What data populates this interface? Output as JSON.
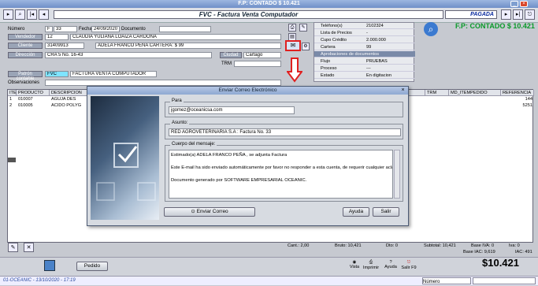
{
  "window": {
    "title": "F.P: CONTADO $ 10.421"
  },
  "form": {
    "title": "FVC - Factura Venta Computador",
    "status": "PAGADA"
  },
  "header": {
    "numero_label": "Número",
    "numero_prefix": "F",
    "numero_value": "33",
    "fecha_label": "Fecha",
    "fecha_value": "24/09/2020",
    "documento_label": "Documento",
    "documento_value": "",
    "vendedor_label": "Vendedor",
    "vendedor_code": "12",
    "vendedor_name": "CLAUDIA YULIANA LOAIZA CARDONA",
    "cliente_label": "Cliente",
    "cliente_code": "31409913",
    "cliente_name": "ADELA  FRANCO PEÑA  CARTERA: $ 99",
    "direccion_label": "Dirección",
    "direccion_value": "CRA 5 No. 16-43",
    "ciudad_label": "Ciudad",
    "ciudad_value": "Cartago",
    "trm_label": "TRM",
    "trm_value": "",
    "patron_label": "Patrón contable",
    "patron_code": "FVC",
    "patron_name": "FACTURA VENTA COMPUTADOR",
    "observaciones_label": "Observaciones",
    "observaciones_value": ""
  },
  "properties": [
    {
      "label": "Teléfono(s)",
      "value": "2102324"
    },
    {
      "label": "Lista de Precios",
      "value": "-"
    },
    {
      "label": "Cupo Crédito",
      "value": "2.000.000"
    },
    {
      "label": "Cartera",
      "value": "99"
    },
    {
      "label": "Aprobaciones de documentos",
      "value": ""
    },
    {
      "label": "Flujo",
      "value": "PRUEBAS"
    },
    {
      "label": "Proceso",
      "value": "---"
    },
    {
      "label": "Estado",
      "value": "En digitacion"
    }
  ],
  "fp_summary": "F.P: CONTADO $ 10.421",
  "grid": {
    "columns": [
      "ITE",
      "PRODUCTO",
      "DESCRIPCION",
      "TRM",
      "MD_ITEMPEDIDO",
      "REFERENCIA"
    ],
    "rows": [
      {
        "ite": "1",
        "producto": "010007",
        "descripcion": "AGUJA DES",
        "referencia": "144"
      },
      {
        "ite": "2",
        "producto": "010005",
        "descripcion": "ACIDO POLYG",
        "referencia": "5251"
      }
    ]
  },
  "email_dialog": {
    "title": "Enviar Correo Electrónico",
    "para_label": "Para",
    "para_value": "jgomez@oceanicsa.com",
    "asunto_label": "Asunto:",
    "asunto_value": "RED AGROVETERINARIA S.A : Factura No. 33",
    "cuerpo_label": "Cuerpo del mensaje:",
    "cuerpo_lines": [
      "Estimado(a) ADELA  FRANCO PEÑA , se adjunta Factura",
      "",
      "Este E-mail ha sido enviado automáticamente por favor no responder a esta cuenta, de requerir cualquier aclaratoria o inf",
      "",
      "Documento generado por SOFTWARE EMPRESARIAL OCEANIC."
    ],
    "send_label": "Enviar Correo",
    "help_label": "Ayuda",
    "exit_label": "Salir"
  },
  "totals": {
    "cant": "Cant.: 2,00",
    "bruto": "Bruto: 10,421",
    "dto": "Dto: 0",
    "subtotal": "Subtotal: 10,421",
    "base_iva": "Base IVA: 0",
    "iva": "Iva: 0",
    "base_iac": "Base IAC: 9,619",
    "iac": "IAC: 491",
    "total": "$10.421"
  },
  "buttons": {
    "pedido": "Pedido",
    "vista": "Vista",
    "imprimir": "Imprimir",
    "ayuda": "Ayuda",
    "salir": "Salir F9"
  },
  "status": {
    "left": "01-OCEANIC - 13/10/2020 - 17:19",
    "numero_label": "Número",
    "field2": ""
  }
}
